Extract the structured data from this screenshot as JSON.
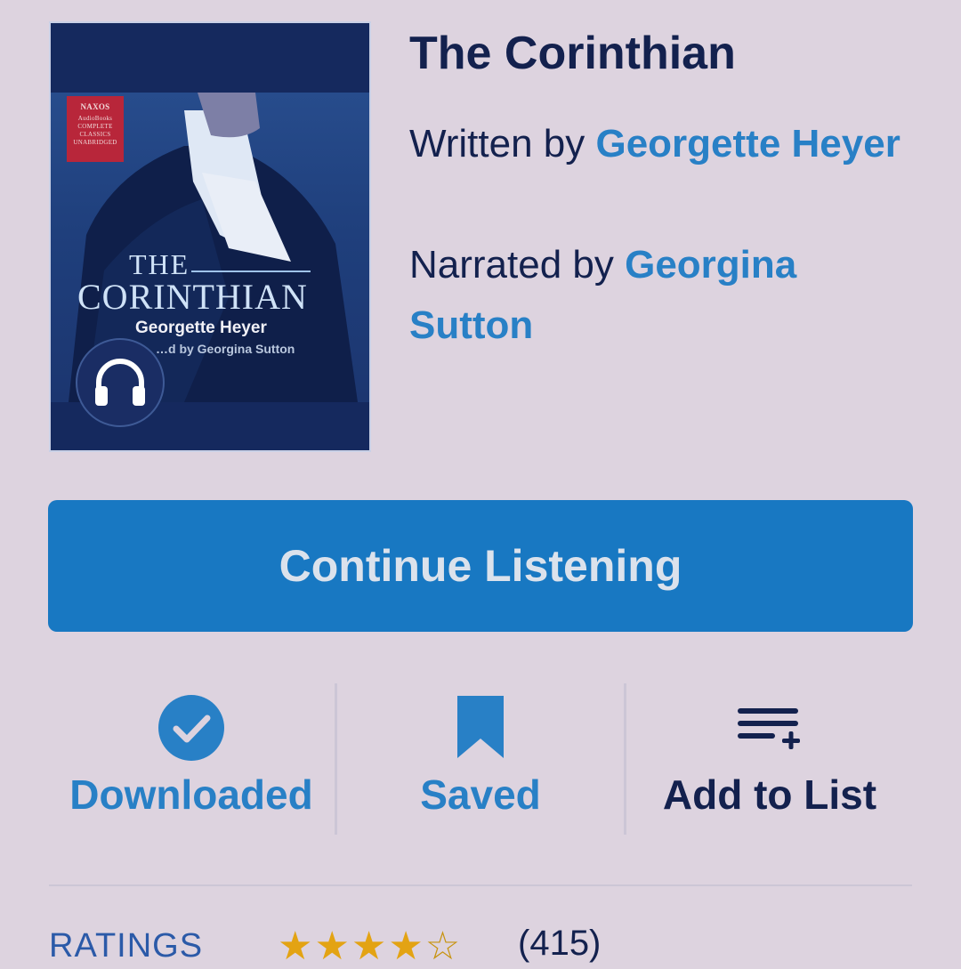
{
  "book": {
    "title": "The Corinthian",
    "written_by_prefix": "Written by ",
    "author": "Georgette Heyer",
    "narrated_by_prefix": "Narrated by ",
    "narrator": "Georgina Sutton"
  },
  "cover": {
    "publisher_name": "NAXOS",
    "publisher_sub": "AudioBooks",
    "badge_line1": "COMPLETE",
    "badge_line2": "CLASSICS",
    "badge_line3": "UNABRIDGED",
    "title_line1": "THE",
    "title_line2": "CORINTHIAN",
    "author": "Georgette Heyer",
    "narrator_line": "…d by Georgina Sutton",
    "format_icon": "headphones-icon"
  },
  "primary_action": {
    "label": "Continue Listening"
  },
  "actions": [
    {
      "label": "Downloaded",
      "icon": "check-circle-icon",
      "color": "#2880c6"
    },
    {
      "label": "Saved",
      "icon": "bookmark-icon",
      "color": "#2880c6"
    },
    {
      "label": "Add to List",
      "icon": "playlist-add-icon",
      "color": "#13214e"
    }
  ],
  "ratings": {
    "label": "RATINGS",
    "stars_filled": "★★★★",
    "stars_empty": "☆",
    "rating_value": 4,
    "rating_max": 5,
    "count": "(415)"
  },
  "colors": {
    "background": "#ddd3df",
    "accent": "#2880c6",
    "button": "#1878c2",
    "text": "#13214e",
    "star": "#e3a313"
  }
}
